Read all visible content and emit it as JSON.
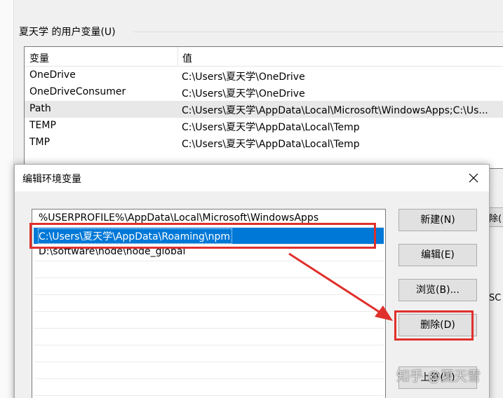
{
  "background_dialog": {
    "group_label": "夏天学 的用户变量(U)",
    "columns": {
      "name": "变量",
      "value": "值"
    },
    "rows": [
      {
        "name": "OneDrive",
        "value": "C:\\Users\\夏天学\\OneDrive"
      },
      {
        "name": "OneDriveConsumer",
        "value": "C:\\Users\\夏天学\\OneDrive"
      },
      {
        "name": "Path",
        "value": "C:\\Users\\夏天学\\AppData\\Local\\Microsoft\\WindowsApps;C:\\Us..."
      },
      {
        "name": "TEMP",
        "value": "C:\\Users\\夏天学\\AppData\\Local\\Temp"
      },
      {
        "name": "TMP",
        "value": "C:\\Users\\夏天学\\AppData\\Local\\Temp"
      }
    ],
    "partial_button": "除(",
    "partial_text": "SC"
  },
  "edit_dialog": {
    "title": "编辑环境变量",
    "paths": [
      "%USERPROFILE%\\AppData\\Local\\Microsoft\\WindowsApps",
      "C:\\Users\\夏天学\\AppData\\Roaming\\npm",
      "D:\\software\\node\\node_global"
    ],
    "buttons": {
      "new": "新建(N)",
      "edit": "编辑(E)",
      "browse": "浏览(B)...",
      "delete": "删除(D)",
      "move_up": "上移(U)"
    }
  },
  "watermark": "知乎 @夏天雪",
  "colors": {
    "selection": "#0078d7",
    "annotation": "#e0302c"
  },
  "icons": {
    "close": "close-icon"
  }
}
